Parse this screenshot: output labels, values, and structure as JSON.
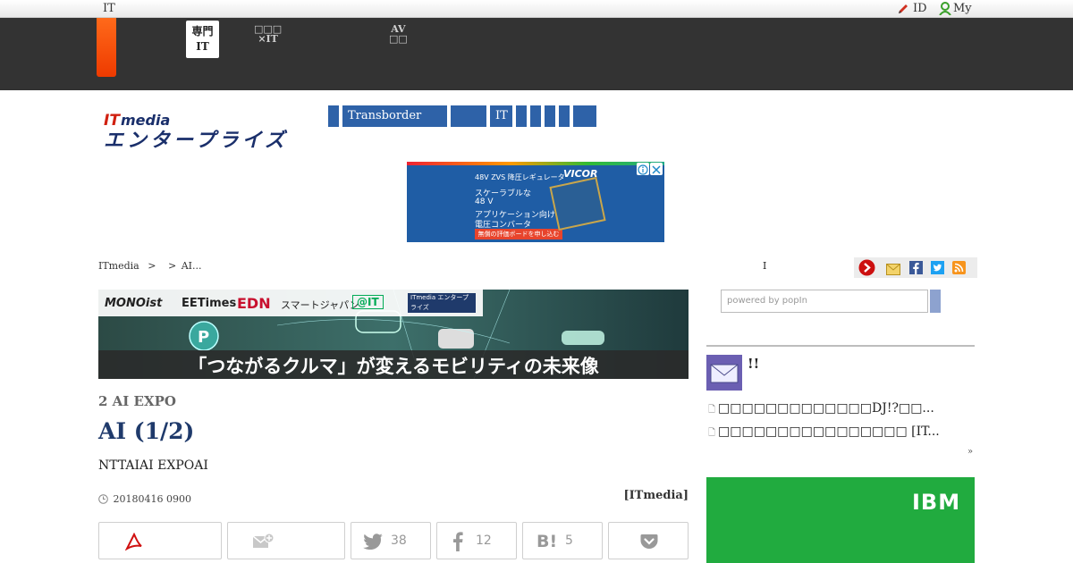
{
  "topbar": {
    "left_label": "IT",
    "id_label": "ID",
    "my_label": "My"
  },
  "darkbar": {
    "tabs": [
      {
        "line1": "専門",
        "line2": "IT"
      },
      {
        "line1": "□□□",
        "line2": "×IT"
      },
      {
        "line1": "AV",
        "line2": "□□"
      }
    ]
  },
  "nav": {
    "items": [
      "",
      "Transborder",
      "",
      "IT",
      "",
      "",
      "",
      ""
    ]
  },
  "ad": {
    "line1": "48V ZVS 降圧レギュレータ",
    "line2": "スケーラブルな",
    "line3": "48 V",
    "line4": "アプリケーション向け",
    "line5": "電圧コンバータ",
    "cta": "無償の評価ボードを申し込む",
    "brand": "VICOR"
  },
  "breadcrumb": {
    "home": "ITmedia",
    "sep1": ">",
    "sep2": ">",
    "current": "AI..."
  },
  "share_strip_marker": "I",
  "banner": {
    "logos": [
      "MONOist",
      "EETimes",
      "EDN",
      "スマートジャパン",
      "@IT",
      "ITmedia エンタープライズ"
    ],
    "caption": "「つながるクルマ」が変えるモビリティの未来像"
  },
  "article": {
    "kicker": "2 AI EXPO",
    "headline": "AI (1/2)",
    "lead": "NTTAIAI EXPOAI",
    "date": "20180416 0900",
    "source": "[ITmedia]"
  },
  "share_buttons": {
    "twitter_count": "38",
    "facebook_count": "12",
    "hatena_count": "5"
  },
  "sidebar": {
    "search_placeholder": "powered by popIn",
    "newsletter_title": "!!",
    "items": [
      "□□□□□□□□□□□□□DJ!?□□...",
      "□□□□□□□□□□□□□□□□ [IT..."
    ],
    "more": "»",
    "ibm_label": "IBM"
  },
  "colors": {
    "nav_blue": "#2e62a8",
    "orange": "#ff5a0a",
    "headline": "#1f3a6b",
    "ibm_green": "#21ab3f"
  }
}
